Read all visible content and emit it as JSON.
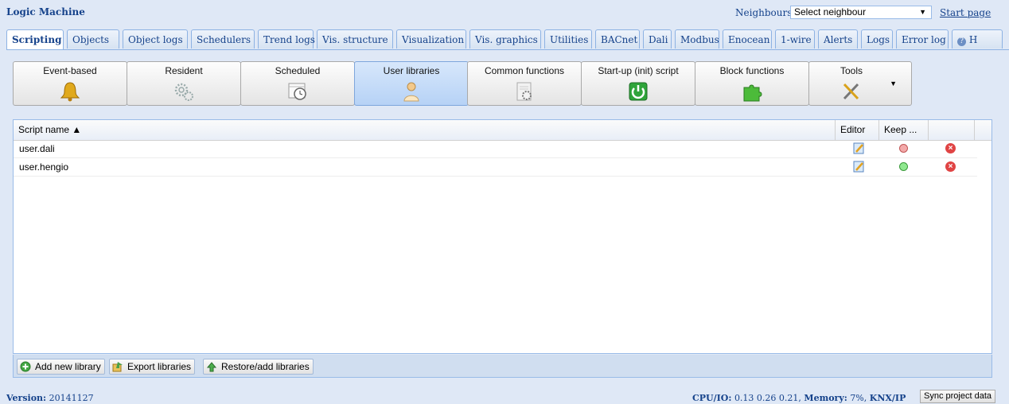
{
  "app": {
    "title": "Logic Machine"
  },
  "neighbours": {
    "label": "Neighbours:",
    "selected": "Select neighbour",
    "start_page": "Start page"
  },
  "tabs": [
    {
      "label": "Scripting"
    },
    {
      "label": "Objects"
    },
    {
      "label": "Object logs"
    },
    {
      "label": "Schedulers"
    },
    {
      "label": "Trend logs"
    },
    {
      "label": "Vis. structure"
    },
    {
      "label": "Visualization"
    },
    {
      "label": "Vis. graphics"
    },
    {
      "label": "Utilities"
    },
    {
      "label": "BACnet"
    },
    {
      "label": "Dali"
    },
    {
      "label": "Modbus"
    },
    {
      "label": "Enocean"
    },
    {
      "label": "1-wire"
    },
    {
      "label": "Alerts"
    },
    {
      "label": "Logs"
    },
    {
      "label": "Error log"
    },
    {
      "label": "H"
    }
  ],
  "toolbar": [
    {
      "label": "Event-based",
      "icon": "bell-icon"
    },
    {
      "label": "Resident",
      "icon": "gears-icon"
    },
    {
      "label": "Scheduled",
      "icon": "calendar-clock-icon"
    },
    {
      "label": "User libraries",
      "icon": "user-icon"
    },
    {
      "label": "Common functions",
      "icon": "document-gear-icon"
    },
    {
      "label": "Start-up (init) script",
      "icon": "power-icon"
    },
    {
      "label": "Block functions",
      "icon": "puzzle-icon"
    },
    {
      "label": "Tools",
      "icon": "tools-icon"
    }
  ],
  "grid": {
    "columns": {
      "name": "Script name ▲",
      "editor": "Editor",
      "keep": "Keep ..."
    },
    "rows": [
      {
        "name": "user.dali",
        "keep": "off"
      },
      {
        "name": "user.hengio",
        "keep": "on"
      }
    ]
  },
  "footer_buttons": {
    "add": "Add new library",
    "export": "Export libraries",
    "restore": "Restore/add libraries"
  },
  "status": {
    "version_label": "Version:",
    "version": "20141127",
    "cpu_label": "CPU/IO:",
    "cpu": "0.13 0.26 0.21,",
    "mem_label": "Memory:",
    "mem": "7%,",
    "knx_label": "KNX/IP",
    "sync": "Sync project data"
  },
  "colors": {
    "accent": "#15428b",
    "panel": "#dfe8f6",
    "border": "#99bbe8"
  }
}
